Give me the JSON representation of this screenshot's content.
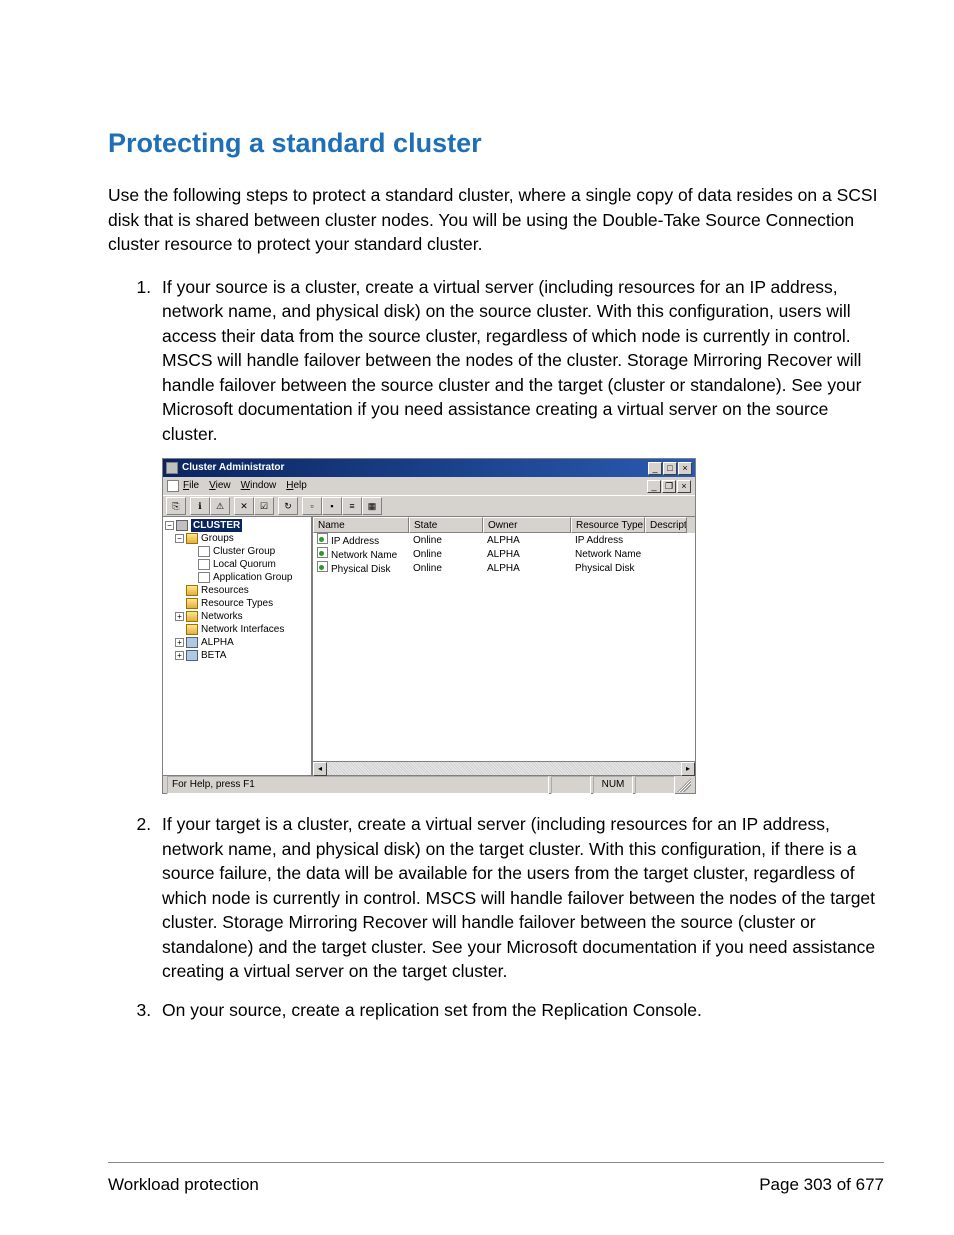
{
  "page": {
    "heading": "Protecting a standard cluster",
    "intro": "Use the following steps to protect a standard cluster, where a single copy of data resides on a SCSI disk that is shared between cluster nodes. You will be using the Double-Take Source Connection cluster resource to protect your standard cluster.",
    "steps": [
      "If your source is a cluster, create a virtual server (including resources for an IP address, network name, and physical disk) on the source cluster. With this configuration, users will access their data from the source cluster, regardless of which node is currently in control. MSCS will handle failover between the nodes of the cluster. Storage Mirroring Recover will handle failover between the source cluster and the target (cluster or standalone). See your Microsoft documentation if you need assistance creating a virtual server on the source cluster.",
      "If your target is a cluster, create a virtual server (including resources for an IP address, network name, and physical disk) on the target cluster. With this configuration, if there is a source failure, the data will be available for the users from the target cluster, regardless of which node is currently in control. MSCS will handle failover between the nodes of the target cluster. Storage Mirroring Recover will handle failover between the source (cluster or standalone) and the target cluster. See your Microsoft documentation if you need assistance creating a virtual server on the target cluster.",
      "On your source, create a replication set from the Replication Console."
    ]
  },
  "cluster_admin": {
    "title": "Cluster Administrator",
    "menus": {
      "file": "File",
      "view": "View",
      "window": "Window",
      "help": "Help"
    },
    "tree": {
      "root": "CLUSTER",
      "groups": "Groups",
      "cluster_group": "Cluster Group",
      "local_quorum": "Local Quorum",
      "application_group": "Application Group",
      "resources": "Resources",
      "resource_types": "Resource Types",
      "networks": "Networks",
      "network_interfaces": "Network Interfaces",
      "alpha": "ALPHA",
      "beta": "BETA"
    },
    "columns": {
      "name": "Name",
      "state": "State",
      "owner": "Owner",
      "type": "Resource Type",
      "desc": "Descript"
    },
    "rows": [
      {
        "name": "IP Address",
        "state": "Online",
        "owner": "ALPHA",
        "type": "IP Address"
      },
      {
        "name": "Network Name",
        "state": "Online",
        "owner": "ALPHA",
        "type": "Network Name"
      },
      {
        "name": "Physical Disk",
        "state": "Online",
        "owner": "ALPHA",
        "type": "Physical Disk"
      }
    ],
    "status": {
      "help": "For Help, press F1",
      "num": "NUM"
    }
  },
  "footer": {
    "section": "Workload protection",
    "page_label": "Page 303 of 677"
  }
}
